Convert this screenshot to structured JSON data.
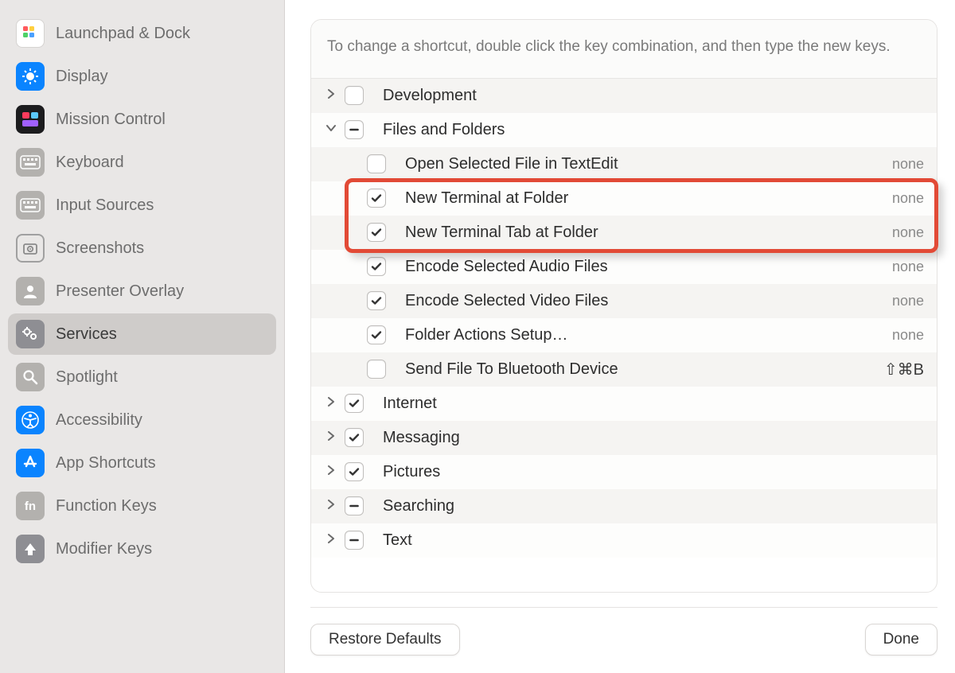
{
  "sidebar": {
    "items": [
      {
        "label": "Launchpad & Dock",
        "icon": "launchpad",
        "selected": false
      },
      {
        "label": "Display",
        "icon": "display",
        "selected": false
      },
      {
        "label": "Mission Control",
        "icon": "mission",
        "selected": false
      },
      {
        "label": "Keyboard",
        "icon": "keyboard",
        "selected": false
      },
      {
        "label": "Input Sources",
        "icon": "keyboard",
        "selected": false
      },
      {
        "label": "Screenshots",
        "icon": "camera",
        "selected": false
      },
      {
        "label": "Presenter Overlay",
        "icon": "person",
        "selected": false
      },
      {
        "label": "Services",
        "icon": "gears",
        "selected": true
      },
      {
        "label": "Spotlight",
        "icon": "search",
        "selected": false
      },
      {
        "label": "Accessibility",
        "icon": "accessibility",
        "selected": false
      },
      {
        "label": "App Shortcuts",
        "icon": "appstore",
        "selected": false
      },
      {
        "label": "Function Keys",
        "icon": "fn",
        "selected": false
      },
      {
        "label": "Modifier Keys",
        "icon": "uparrow",
        "selected": false
      }
    ]
  },
  "instructions": "To change a shortcut, double click the key combination, and then type the new keys.",
  "items": [
    {
      "type": "group",
      "label": "Development",
      "expanded": false,
      "check": "empty",
      "alt": true
    },
    {
      "type": "group",
      "label": "Files and Folders",
      "expanded": true,
      "check": "mixed",
      "alt": false
    },
    {
      "type": "child",
      "label": "Open Selected File in TextEdit",
      "check": "empty",
      "shortcut": "none",
      "alt": true
    },
    {
      "type": "child",
      "label": "New Terminal at Folder",
      "check": "checked",
      "shortcut": "none",
      "alt": false,
      "highlighted": true
    },
    {
      "type": "child",
      "label": "New Terminal Tab at Folder",
      "check": "checked",
      "shortcut": "none",
      "alt": true,
      "highlighted": true
    },
    {
      "type": "child",
      "label": "Encode Selected Audio Files",
      "check": "checked",
      "shortcut": "none",
      "alt": false
    },
    {
      "type": "child",
      "label": "Encode Selected Video Files",
      "check": "checked",
      "shortcut": "none",
      "alt": true
    },
    {
      "type": "child",
      "label": "Folder Actions Setup…",
      "check": "checked",
      "shortcut": "none",
      "alt": false
    },
    {
      "type": "child",
      "label": "Send File To Bluetooth Device",
      "check": "empty",
      "shortcut": "⇧⌘B",
      "shortcut_key": true,
      "alt": true
    },
    {
      "type": "group",
      "label": "Internet",
      "expanded": false,
      "check": "checked",
      "alt": false
    },
    {
      "type": "group",
      "label": "Messaging",
      "expanded": false,
      "check": "checked",
      "alt": true
    },
    {
      "type": "group",
      "label": "Pictures",
      "expanded": false,
      "check": "checked",
      "alt": false
    },
    {
      "type": "group",
      "label": "Searching",
      "expanded": false,
      "check": "mixed",
      "alt": true
    },
    {
      "type": "group",
      "label": "Text",
      "expanded": false,
      "check": "mixed",
      "alt": false
    }
  ],
  "buttons": {
    "restore": "Restore Defaults",
    "done": "Done"
  }
}
